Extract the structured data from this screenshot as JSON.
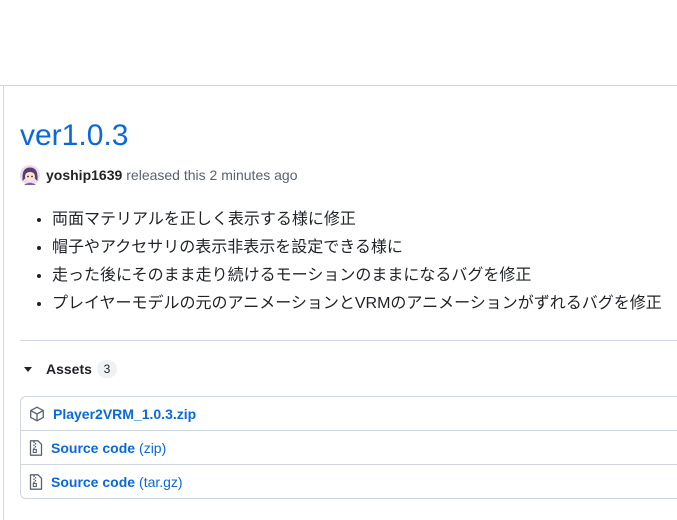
{
  "release": {
    "title": "ver1.0.3",
    "author": "yoship1639",
    "released_text": "released this 2 minutes ago",
    "notes": [
      "両面マテリアルを正しく表示する様に修正",
      "帽子やアクセサリの表示非表示を設定できる様に",
      "走った後にそのまま走り続けるモーションのままになるバグを修正",
      "プレイヤーモデルの元のアニメーションとVRMのアニメーションがずれるバグを修正"
    ]
  },
  "assets": {
    "label": "Assets",
    "count": "3",
    "items": [
      {
        "name": "Player2VRM_1.0.3.zip",
        "suffix": "",
        "icon": "package-icon"
      },
      {
        "name": "Source code",
        "suffix": "(zip)",
        "icon": "file-zip-icon"
      },
      {
        "name": "Source code",
        "suffix": "(tar.gz)",
        "icon": "file-zip-icon"
      }
    ]
  },
  "colors": {
    "link": "#0969da",
    "text": "#1f2328",
    "muted": "#59636e",
    "border": "#d0d7de"
  }
}
